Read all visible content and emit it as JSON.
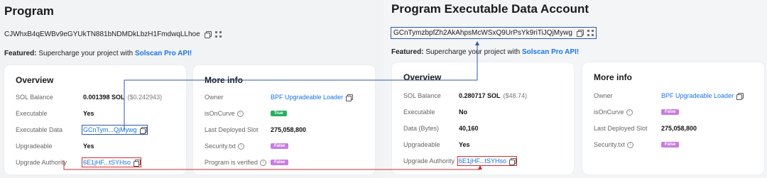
{
  "left": {
    "title": "Program",
    "address": "CJWhxB4qEWBv9eGYUkTN881bNDMDkLbzH1FmdwqLLhoe",
    "featured_prefix": "Featured:",
    "featured_text": " Supercharge your project with ",
    "featured_link": "Solscan Pro API!",
    "overview": {
      "title": "Overview",
      "rows": [
        {
          "label": "SOL Balance",
          "value": "0.001398 SOL",
          "sub": "($0.242943)"
        },
        {
          "label": "Executable",
          "value": "Yes"
        },
        {
          "label": "Executable Data",
          "value": "GCnTym...QjMywg"
        },
        {
          "label": "Upgradeable",
          "value": "Yes"
        },
        {
          "label": "Upgrade Authority",
          "value": "6E1jHF...tSYHso"
        }
      ]
    },
    "more_info": {
      "title": "More info",
      "rows": [
        {
          "label": "Owner",
          "value": "BPF Upgradeable Loader"
        },
        {
          "label": "isOnCurve",
          "badge": "True"
        },
        {
          "label": "Last Deployed Slot",
          "value": "275,058,800"
        },
        {
          "label": "Security.txt",
          "badge": "False"
        },
        {
          "label": "Program is verified",
          "badge": "False"
        }
      ]
    }
  },
  "right": {
    "title": "Program Executable Data Account",
    "address": "GCnTymzbpfZh2AkAhpsMcWSxQ9UrPsYk9riTiJQjMywg",
    "featured_prefix": "Featured:",
    "featured_text": " Supercharge your project with ",
    "featured_link": "Solscan Pro API!",
    "overview": {
      "title": "Overview",
      "rows": [
        {
          "label": "SOL Balance",
          "value": "0.280717 SOL",
          "sub": "($48.74)"
        },
        {
          "label": "Executable",
          "value": "No"
        },
        {
          "label": "Data (Bytes)",
          "value": "40,160"
        },
        {
          "label": "Upgradeable",
          "value": "Yes"
        },
        {
          "label": "Upgrade Authority",
          "value": "6E1jHF...tSYHso"
        }
      ]
    },
    "more_info": {
      "title": "More info",
      "rows": [
        {
          "label": "Owner",
          "value": "BPF Upgradeable Loader"
        },
        {
          "label": "isOnCurve",
          "badge": "False"
        },
        {
          "label": "Last Deployed Slot",
          "value": "275,058,800"
        },
        {
          "label": "Security.txt",
          "badge": "False"
        }
      ]
    }
  },
  "colors": {
    "link": "#1a73e8",
    "highlight_blue": "#2b5aa6",
    "highlight_red": "#d32f2f",
    "badge_true": "#27ae60",
    "badge_false": "#c97be0"
  }
}
